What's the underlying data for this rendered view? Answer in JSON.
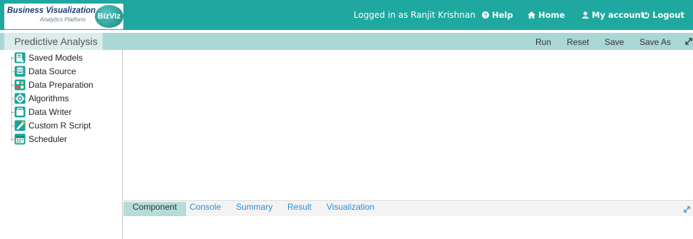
{
  "header": {
    "logo_title": "Business Visualization",
    "logo_subtitle": "Analytics Platform",
    "logo_badge": "BizViz",
    "logged_in_text": "Logged in as Ranjit Krishnan",
    "help_label": "Help",
    "home_label": "Home",
    "account_label": "My account",
    "logout_label": "Logout",
    "color": "#1fa8a0"
  },
  "toolbar": {
    "page_title": "Predictive Analysis",
    "run_label": "Run",
    "reset_label": "Reset",
    "save_label": "Save",
    "save_as_label": "Save As"
  },
  "tree": {
    "items": [
      {
        "label": "Saved Models",
        "icon": "saved-models-icon"
      },
      {
        "label": "Data Source",
        "icon": "database-icon"
      },
      {
        "label": "Data Preparation",
        "icon": "data-preparation-icon"
      },
      {
        "label": "Algorithms",
        "icon": "algorithm-icon"
      },
      {
        "label": "Data Writer",
        "icon": "data-writer-icon"
      },
      {
        "label": "Custom R Script",
        "icon": "custom-script-icon"
      },
      {
        "label": "Scheduler",
        "icon": "scheduler-icon"
      }
    ]
  },
  "bottom_tabs": {
    "component": "Component",
    "console": "Console",
    "summary": "Summary",
    "result": "Result",
    "visualization": "Visualization",
    "active": "Component"
  }
}
